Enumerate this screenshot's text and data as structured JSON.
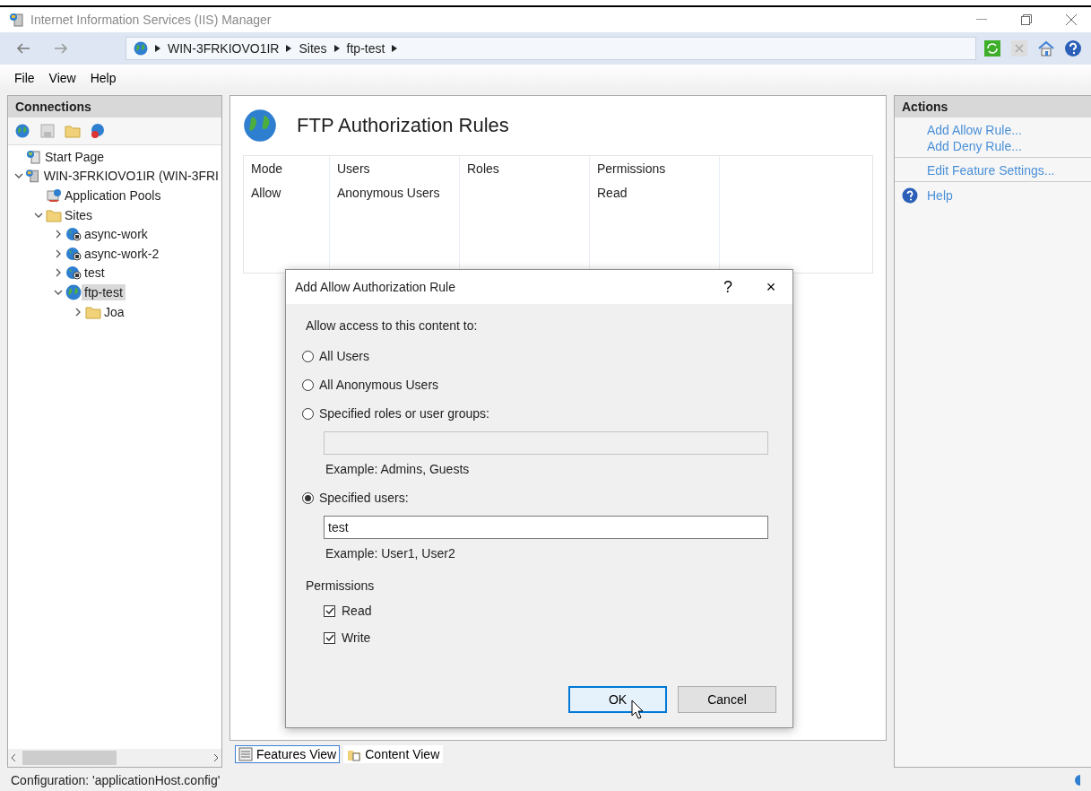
{
  "window": {
    "title": "Internet Information Services (IIS) Manager"
  },
  "address_bar": {
    "crumbs": [
      "WIN-3FRKIOVO1IR",
      "Sites",
      "ftp-test"
    ]
  },
  "menu": [
    "File",
    "View",
    "Help"
  ],
  "connections": {
    "title": "Connections",
    "tree": [
      {
        "label": "Start Page",
        "kind": "start",
        "selected": false
      },
      {
        "label": "WIN-3FRKIOVO1IR (WIN-3FRI",
        "kind": "server",
        "selected": false,
        "expanded": true,
        "children": [
          {
            "label": "Application Pools",
            "kind": "pools",
            "selected": false
          },
          {
            "label": "Sites",
            "kind": "sites",
            "selected": false,
            "expanded": true,
            "children": [
              {
                "label": "async-work",
                "kind": "site",
                "selected": false,
                "expanded": false
              },
              {
                "label": "async-work-2",
                "kind": "site",
                "selected": false,
                "expanded": false
              },
              {
                "label": "test",
                "kind": "site",
                "selected": false,
                "expanded": false
              },
              {
                "label": "ftp-test",
                "kind": "ftp",
                "selected": true,
                "expanded": true,
                "children": [
                  {
                    "label": "Joa",
                    "kind": "folder",
                    "selected": false,
                    "expanded": false
                  }
                ]
              }
            ]
          }
        ]
      }
    ]
  },
  "feature": {
    "title": "FTP Authorization Rules",
    "table": {
      "columns": [
        "Mode",
        "Users",
        "Roles",
        "Permissions"
      ],
      "rows": [
        [
          "Allow",
          "Anonymous Users",
          "",
          "Read"
        ]
      ]
    },
    "views": [
      {
        "label": "Features View",
        "selected": true
      },
      {
        "label": "Content View",
        "selected": false
      }
    ]
  },
  "actions": {
    "title": "Actions",
    "groups": [
      [
        "Add Allow Rule...",
        "Add Deny Rule..."
      ],
      [
        "Edit Feature Settings..."
      ]
    ],
    "help": "Help"
  },
  "dialog": {
    "title": "Add Allow Authorization Rule",
    "help": "?",
    "close": "×",
    "prompt": "Allow access to this content to:",
    "options": [
      {
        "label": "All Users",
        "selected": false
      },
      {
        "label": "All Anonymous Users",
        "selected": false
      },
      {
        "label": "Specified roles or user groups:",
        "selected": false,
        "field": {
          "disabled": true,
          "example": "Example: Admins, Guests"
        }
      },
      {
        "label": "Specified users:",
        "selected": true,
        "field": {
          "disabled": false,
          "value": "test",
          "example": "Example: User1, User2"
        }
      }
    ],
    "permissions": {
      "label": "Permissions",
      "items": [
        {
          "label": "Read",
          "checked": true
        },
        {
          "label": "Write",
          "checked": true
        }
      ]
    },
    "buttons": [
      {
        "label": "OK",
        "default": true
      },
      {
        "label": "Cancel",
        "default": false
      }
    ]
  },
  "status_bar": {
    "text": "Configuration: 'applicationHost.config'"
  }
}
